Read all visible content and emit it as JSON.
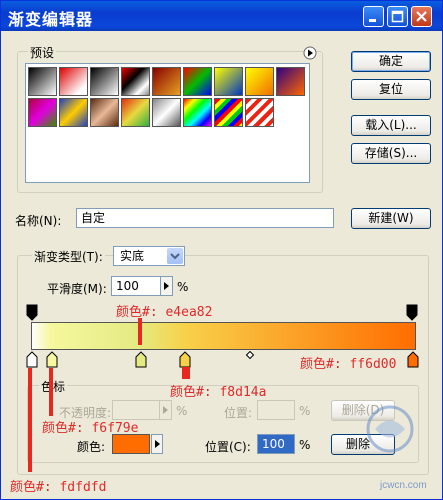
{
  "window": {
    "title": "渐变编辑器"
  },
  "buttons": {
    "ok": "确定",
    "reset": "复位",
    "load": "载入(L)...",
    "save": "存储(S)...",
    "new": "新建(W)"
  },
  "presets": {
    "label": "预设"
  },
  "name": {
    "label": "名称(N):",
    "value": "自定"
  },
  "gradient_type": {
    "label": "渐变类型(T):",
    "value": "实底"
  },
  "smoothness": {
    "label": "平滑度(M):",
    "value": "100",
    "unit": "%"
  },
  "stops": {
    "colors": [
      "#fdfdfd",
      "#f6f79e",
      "#e4ea82",
      "#f8d14a",
      "#ff6d00"
    ],
    "opacity_percent": [
      100,
      100
    ]
  },
  "stops_group": {
    "label": "色标",
    "opacity_label": "不透明度:",
    "opacity_unit": "%",
    "location_label1": "位置:",
    "location_unit1": "%",
    "delete1": "删除(D)",
    "color_label": "颜色:",
    "location_label2": "位置(C):",
    "location_value": "100",
    "location_unit2": "%",
    "delete2": "删除"
  },
  "annotations": {
    "a1": "颜色#: e4ea82",
    "a2": "颜色#: ff6d00",
    "a3": "颜色#: f8d14a",
    "a4": "颜色#: f6f79e",
    "a5": "颜色#: fdfdfd"
  },
  "watermark": {
    "text": "jcwcn.com"
  },
  "colors": {
    "accent_red": "#e8281e",
    "title_blue": "#0a5ee0",
    "selected_stop": "#ff6d00"
  }
}
